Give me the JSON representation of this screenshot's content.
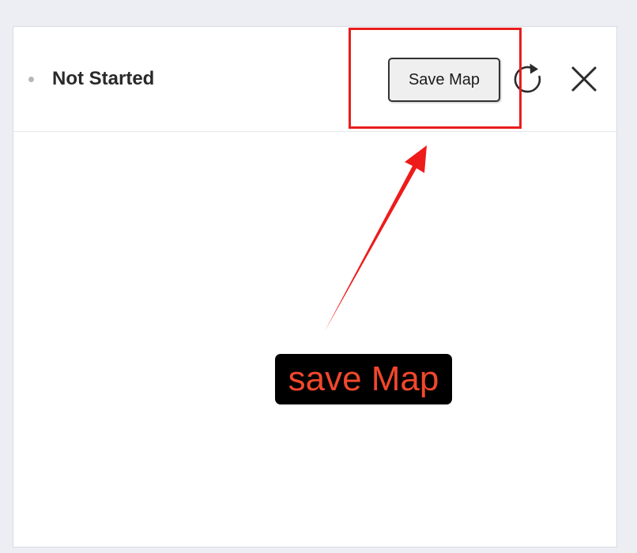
{
  "panel": {
    "status_label": "Not Started",
    "status_dot_color": "#b7b7b7",
    "save_button_label": "Save Map",
    "refresh_icon": "refresh-icon",
    "close_icon": "close-icon"
  },
  "annotation": {
    "callout_text": "save Map",
    "highlight_color": "#e81d1d",
    "callout_text_color": "#f1472c"
  }
}
